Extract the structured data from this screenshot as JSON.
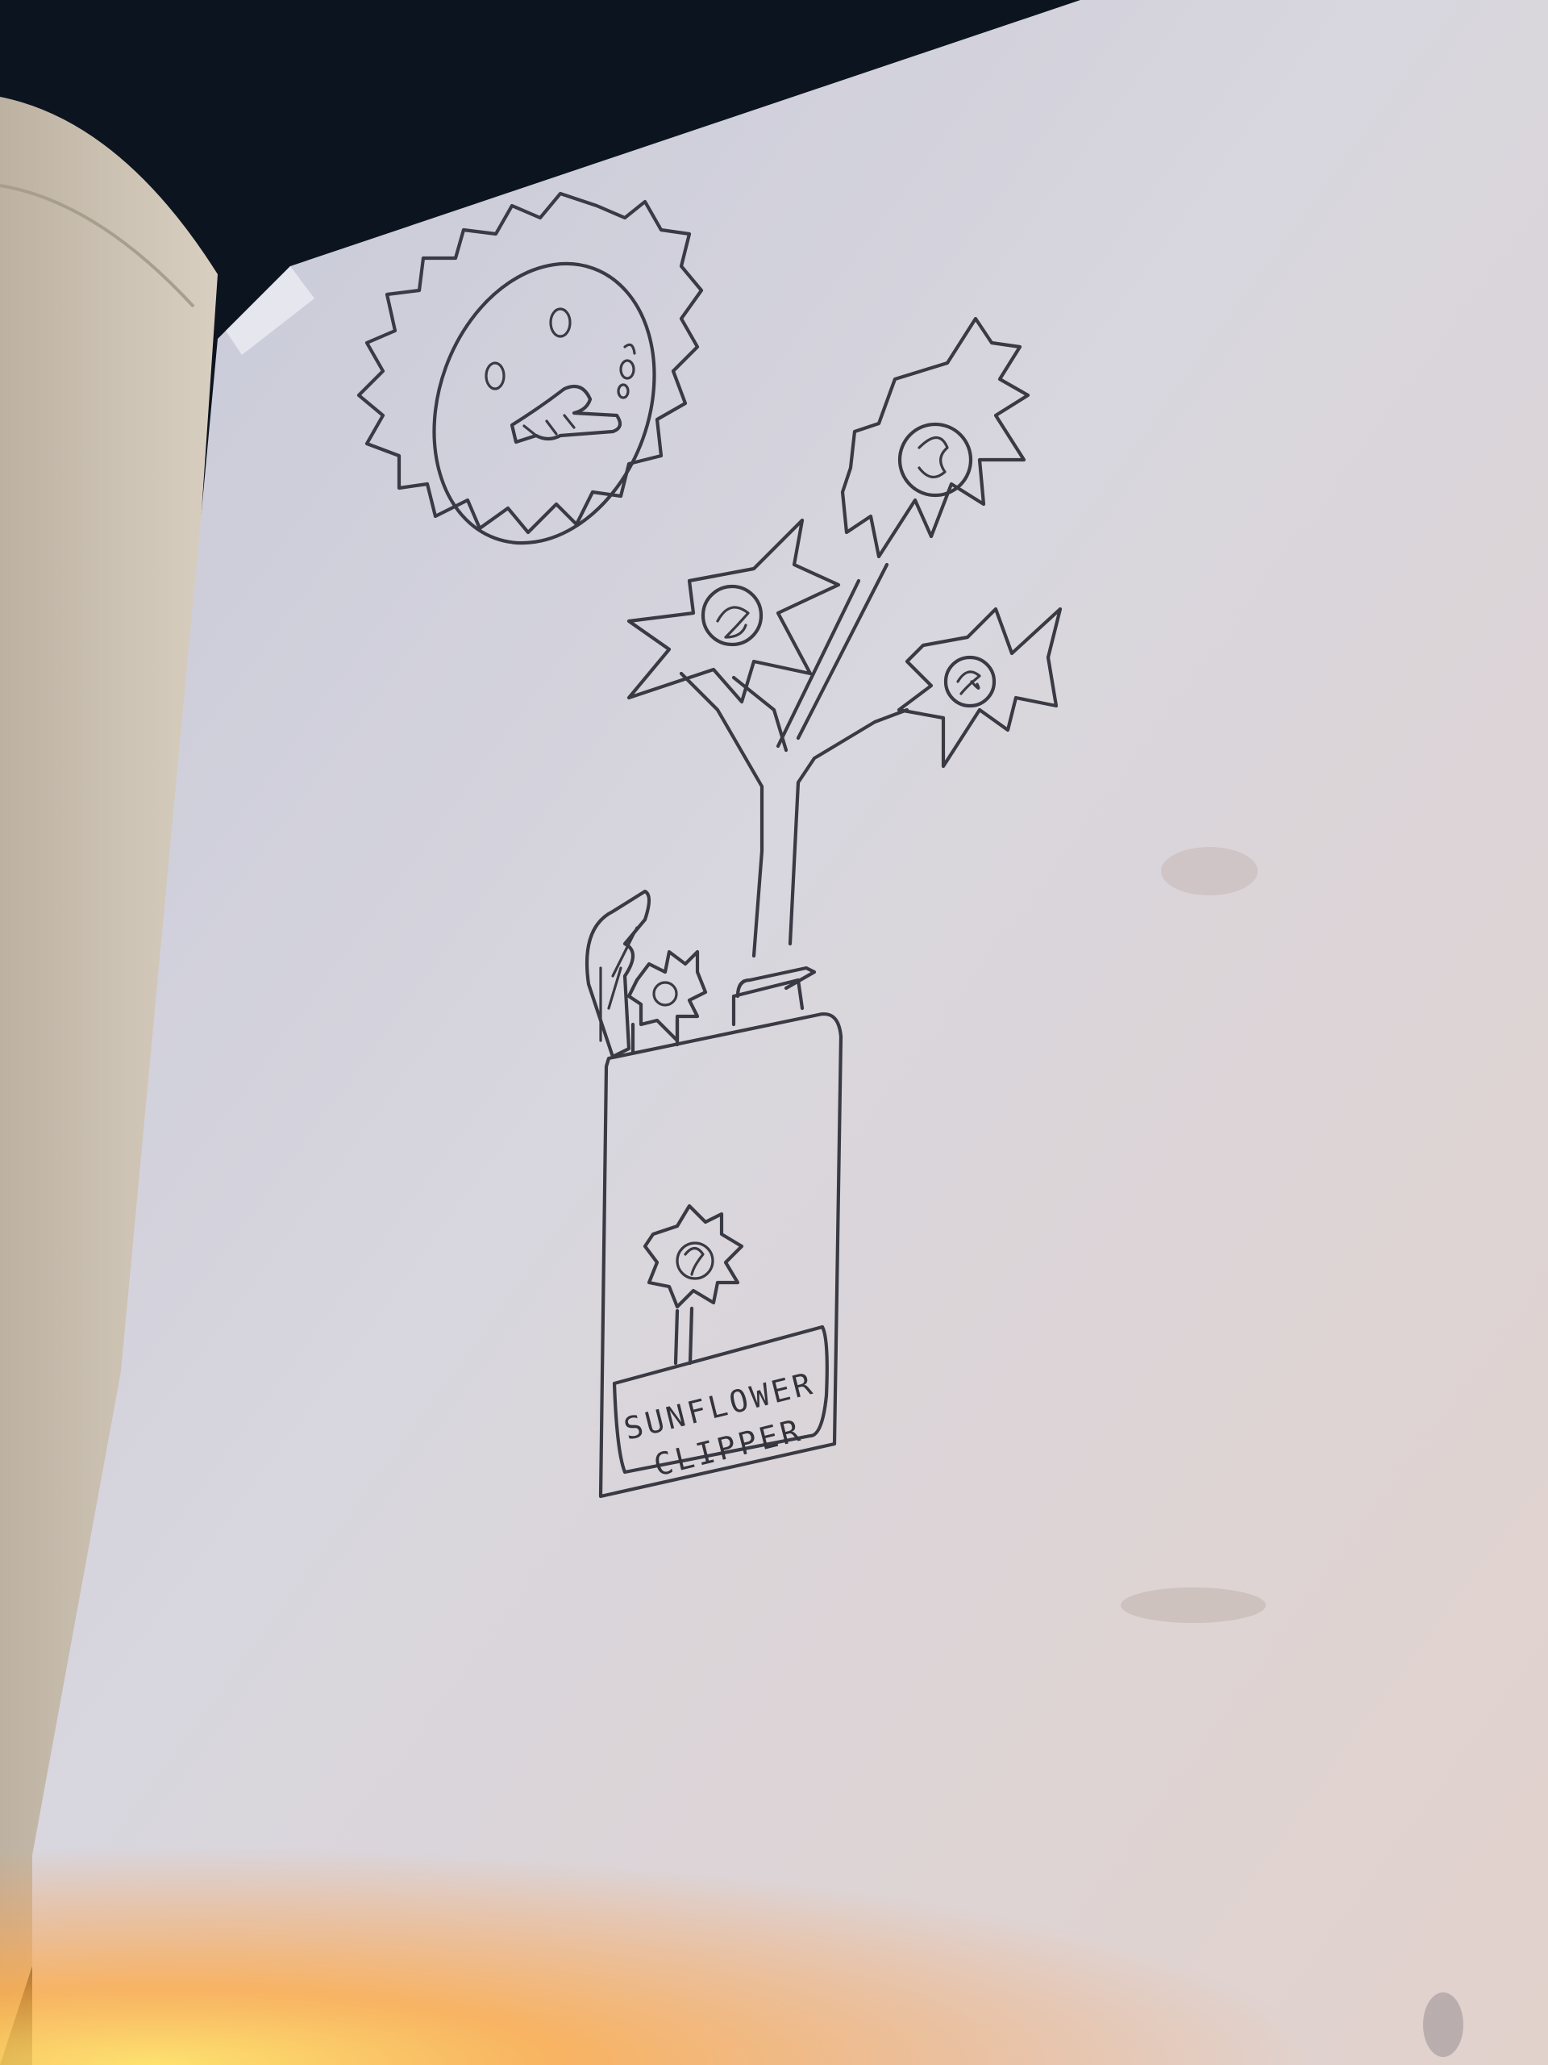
{
  "drawing": {
    "subject": "sunflower-clipper-sketch",
    "packet_label_line1": "SUNFLOWER",
    "packet_label_line2": "CLIPPER"
  },
  "colors": {
    "paper": "#d9d8e0",
    "ink": "#3a3a44",
    "backdrop": "#0c1420",
    "light_leak": "#ffb040"
  }
}
